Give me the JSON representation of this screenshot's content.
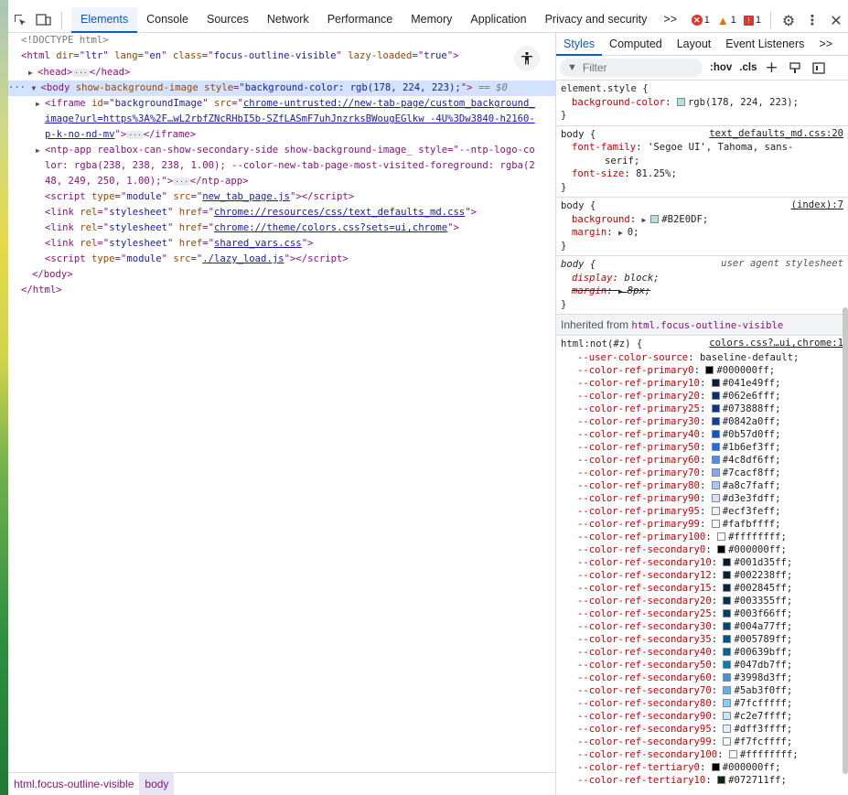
{
  "toolbar": {
    "tabs": [
      "Elements",
      "Console",
      "Sources",
      "Network",
      "Performance",
      "Memory",
      "Application",
      "Privacy and security"
    ],
    "more": ">>",
    "errors": "1",
    "warnings": "1",
    "issues": "1"
  },
  "dom": {
    "doctype": "<!DOCTYPE html>",
    "html_open": {
      "tag": "html",
      "dir": "ltr",
      "lang": "en",
      "class": "focus-outline-visible",
      "lazy_loaded": "true"
    },
    "head": "head",
    "body_style": "background-color: rgb(178, 224, 223);",
    "body_attr": "show-background-image",
    "selected_marker": "== $0",
    "iframe": {
      "id": "backgroundImage",
      "src_l1": "chrome-untrusted://new-tab-page/custom_background_",
      "src_l2": "image?url=https%3A%2F…wL2rbfZNcRHbI5b-SZfLASmF7uhJnzrksBWougEGlkw -4U%3Dw3840-h2160-",
      "src_l3": "p-k-no-nd-mv"
    },
    "ntp": {
      "l1": "<ntp-app realbox-can-show-secondary-side show-background-image_ style=\"--ntp-logo-co",
      "l2": "lor: rgba(238, 238, 238, 1.00); --color-new-tab-page-most-visited-foreground: rgba(2",
      "l3": "48, 249, 250, 1.00);\">"
    },
    "script1_src": "new_tab_page.js",
    "link1_href": "chrome://resources/css/text_defaults_md.css",
    "link2_href": "chrome://theme/colors.css?sets=ui,chrome",
    "link3_href": "shared_vars.css",
    "script2_src": "./lazy_load.js"
  },
  "breadcrumb": [
    "html.focus-outline-visible",
    "body"
  ],
  "styles": {
    "tabs": [
      "Styles",
      "Computed",
      "Layout",
      "Event Listeners"
    ],
    "more": ">>",
    "filter_placeholder": "Filter",
    "hov": ":hov",
    "cls": ".cls",
    "element_style": {
      "selector": "element.style {",
      "prop": "background-color",
      "value": "rgb(178, 224, 223);",
      "swatch": "#b2e0df"
    },
    "rule1": {
      "selector": "body {",
      "source": "text_defaults_md.css:20",
      "ff_prop": "font-family",
      "ff_val": "'Segoe UI', Tahoma, sans-",
      "ff_val2": "serif;",
      "fs_prop": "font-size",
      "fs_val": "81.25%;"
    },
    "rule2": {
      "selector": "body {",
      "source": "(index):7",
      "bg_prop": "background",
      "bg_val": "#B2E0DF;",
      "bg_swatch": "#b2e0df",
      "m_prop": "margin",
      "m_val": "0;"
    },
    "rule3": {
      "selector": "body {",
      "source": "user agent stylesheet",
      "d_prop": "display",
      "d_val": "block;",
      "m_prop": "margin",
      "m_val": "8px;"
    },
    "inherited_label": "Inherited from",
    "inherited_from": "html.focus-outline-visible",
    "rule4": {
      "selector": "html:not(#z) {",
      "source": "colors.css?…ui,chrome:1"
    },
    "vars": [
      {
        "name": "--user-color-source",
        "value": "baseline-default;",
        "color": ""
      },
      {
        "name": "--color-ref-primary0",
        "value": "#000000ff;",
        "color": "#000000"
      },
      {
        "name": "--color-ref-primary10",
        "value": "#041e49ff;",
        "color": "#041e49"
      },
      {
        "name": "--color-ref-primary20",
        "value": "#062e6fff;",
        "color": "#062e6f"
      },
      {
        "name": "--color-ref-primary25",
        "value": "#073888ff;",
        "color": "#073888"
      },
      {
        "name": "--color-ref-primary30",
        "value": "#0842a0ff;",
        "color": "#0842a0"
      },
      {
        "name": "--color-ref-primary40",
        "value": "#0b57d0ff;",
        "color": "#0b57d0"
      },
      {
        "name": "--color-ref-primary50",
        "value": "#1b6ef3ff;",
        "color": "#1b6ef3"
      },
      {
        "name": "--color-ref-primary60",
        "value": "#4c8df6ff;",
        "color": "#4c8df6"
      },
      {
        "name": "--color-ref-primary70",
        "value": "#7cacf8ff;",
        "color": "#7cacf8"
      },
      {
        "name": "--color-ref-primary80",
        "value": "#a8c7faff;",
        "color": "#a8c7fa"
      },
      {
        "name": "--color-ref-primary90",
        "value": "#d3e3fdff;",
        "color": "#d3e3fd"
      },
      {
        "name": "--color-ref-primary95",
        "value": "#ecf3feff;",
        "color": "#ecf3fe"
      },
      {
        "name": "--color-ref-primary99",
        "value": "#fafbffff;",
        "color": "#fafbff"
      },
      {
        "name": "--color-ref-primary100",
        "value": "#ffffffff;",
        "color": "#ffffff"
      },
      {
        "name": "--color-ref-secondary0",
        "value": "#000000ff;",
        "color": "#000000"
      },
      {
        "name": "--color-ref-secondary10",
        "value": "#001d35ff;",
        "color": "#001d35"
      },
      {
        "name": "--color-ref-secondary12",
        "value": "#002238ff;",
        "color": "#002238"
      },
      {
        "name": "--color-ref-secondary15",
        "value": "#002845ff;",
        "color": "#002845"
      },
      {
        "name": "--color-ref-secondary20",
        "value": "#003355ff;",
        "color": "#003355"
      },
      {
        "name": "--color-ref-secondary25",
        "value": "#003f66ff;",
        "color": "#003f66"
      },
      {
        "name": "--color-ref-secondary30",
        "value": "#004a77ff;",
        "color": "#004a77"
      },
      {
        "name": "--color-ref-secondary35",
        "value": "#005789ff;",
        "color": "#005789"
      },
      {
        "name": "--color-ref-secondary40",
        "value": "#00639bff;",
        "color": "#00639b"
      },
      {
        "name": "--color-ref-secondary50",
        "value": "#047db7ff;",
        "color": "#047db7"
      },
      {
        "name": "--color-ref-secondary60",
        "value": "#3998d3ff;",
        "color": "#3998d3"
      },
      {
        "name": "--color-ref-secondary70",
        "value": "#5ab3f0ff;",
        "color": "#5ab3f0"
      },
      {
        "name": "--color-ref-secondary80",
        "value": "#7fcfffff;",
        "color": "#7fcfff"
      },
      {
        "name": "--color-ref-secondary90",
        "value": "#c2e7ffff;",
        "color": "#c2e7ff"
      },
      {
        "name": "--color-ref-secondary95",
        "value": "#dff3ffff;",
        "color": "#dff3ff"
      },
      {
        "name": "--color-ref-secondary99",
        "value": "#f7fcffff;",
        "color": "#f7fcff"
      },
      {
        "name": "--color-ref-secondary100",
        "value": "#ffffffff;",
        "color": "#ffffff"
      },
      {
        "name": "--color-ref-tertiary0",
        "value": "#000000ff;",
        "color": "#000000"
      },
      {
        "name": "--color-ref-tertiary10",
        "value": "#072711ff;",
        "color": "#072711"
      }
    ]
  }
}
